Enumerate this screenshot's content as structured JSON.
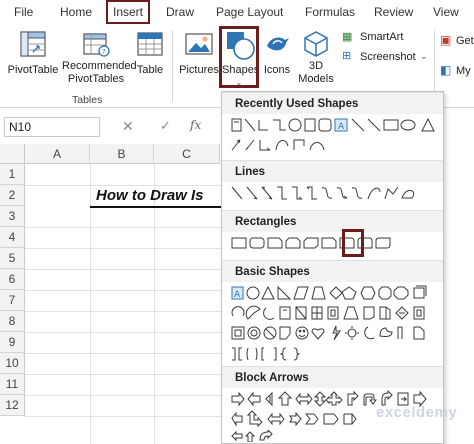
{
  "tabs": {
    "file": "File",
    "home": "Home",
    "insert": "Insert",
    "draw": "Draw",
    "page_layout": "Page Layout",
    "formulas": "Formulas",
    "review": "Review",
    "view": "View"
  },
  "ribbon": {
    "pivottable": "PivotTable",
    "recommended_line1": "Recommended",
    "recommended_line2": "PivotTables",
    "table": "Table",
    "tables_group": "Tables",
    "pictures": "Pictures",
    "shapes": "Shapes",
    "icons": "Icons",
    "models_line1": "3D",
    "models_line2": "Models",
    "smartart": "SmartArt",
    "screenshot": "Screenshot",
    "get_addins": "Get",
    "my_addins": "My"
  },
  "formula_bar": {
    "name_box": "N10",
    "cancel_glyph": "✕",
    "enter_glyph": "✓",
    "fx_label": "fx"
  },
  "grid": {
    "columns": [
      "A",
      "B",
      "C"
    ],
    "rows": [
      "1",
      "2",
      "3",
      "4",
      "5",
      "6",
      "7",
      "8",
      "9",
      "10",
      "11",
      "12"
    ],
    "title_text": "How to Draw Is"
  },
  "shapes_menu": {
    "recently_used": "Recently Used Shapes",
    "lines": "Lines",
    "rectangles": "Rectangles",
    "basic_shapes": "Basic Shapes",
    "block_arrows": "Block Arrows"
  },
  "watermark": "exceldemy",
  "colors": {
    "highlight": "#6b1c1c",
    "accent_blue": "#2e75b6",
    "shape_outline": "#3a3a3a"
  }
}
